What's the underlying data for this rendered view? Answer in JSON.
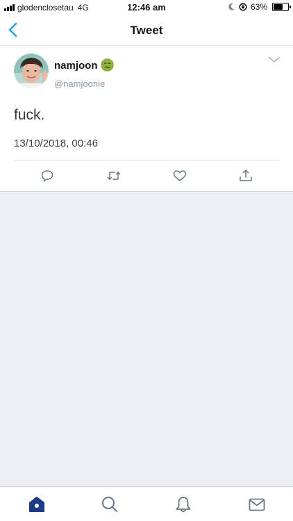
{
  "status_bar": {
    "carrier": "glodenclosetau",
    "network": "4G",
    "time": "12:46 am",
    "battery_percent": "63%",
    "battery_level": 0.63
  },
  "nav": {
    "title": "Tweet"
  },
  "tweet": {
    "display_name": "namjoon",
    "username": "@namjoonie",
    "text": "fuck.",
    "timestamp": "13/10/2018, 00:46"
  },
  "colors": {
    "accent": "#1da1f2",
    "nav_accent": "#1b3a8a",
    "icon_gray": "#657786",
    "background": "#eeeff3"
  }
}
